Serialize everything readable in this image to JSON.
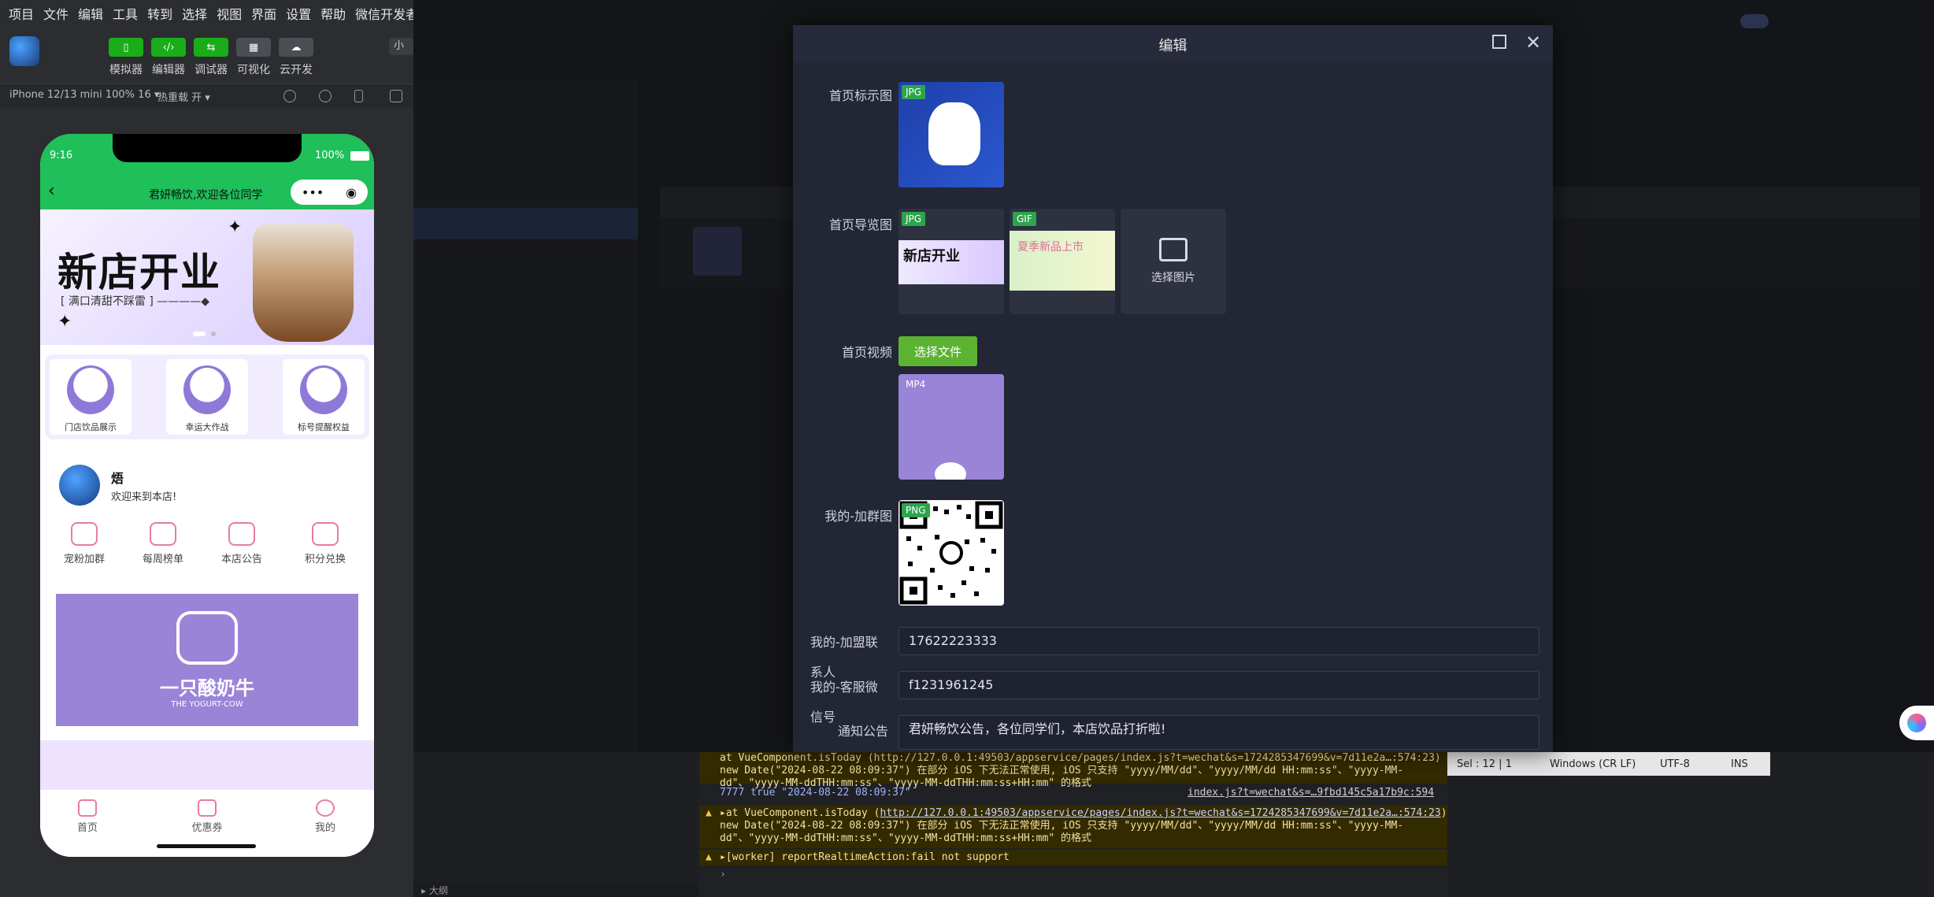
{
  "menubar": [
    "项目",
    "文件",
    "编辑",
    "工具",
    "转到",
    "选择",
    "视图",
    "界面",
    "设置",
    "帮助",
    "微信开发者工具"
  ],
  "toolbar": {
    "items": [
      {
        "icon": "phone-icon",
        "label": "模拟器"
      },
      {
        "icon": "code-icon",
        "label": "编辑器"
      },
      {
        "icon": "debug-icon",
        "label": "调试器"
      },
      {
        "icon": "visual-icon",
        "label": "可视化"
      },
      {
        "icon": "cloud-icon",
        "label": "云开发"
      }
    ],
    "small_btn": "小程"
  },
  "simulator": {
    "device": "iPhone 12/13 mini 100% 16 ▾",
    "hot_reload": "热重载 开 ▾"
  },
  "phone": {
    "time": "9:16",
    "battery": "100%",
    "nav_title": "君妍畅饮,欢迎各位同学",
    "capsule_dots": "•••",
    "banner_title": "新店开业",
    "banner_sub": "[ 满口清甜不踩雷 ] ————◆",
    "cards": [
      "门店饮品展示",
      "幸运大作战",
      "标号提醒权益"
    ],
    "user_name": "焐",
    "user_welcome": "欢迎来到本店!",
    "grid": [
      "宠粉加群",
      "每周榜单",
      "本店公告",
      "积分兑换"
    ],
    "brand_name": "一只酸奶牛",
    "brand_en": "THE YOGURT-COW",
    "tabs": [
      "首页",
      "优惠券",
      "我的"
    ]
  },
  "modal": {
    "title": "编辑",
    "labels": {
      "logo": "首页标示图",
      "carousel": "首页导览图",
      "video": "首页视频",
      "group": "我的-加群图",
      "franchise_l1": "我的-加盟联",
      "franchise_l2": "系人",
      "service_l1": "我的-客服微",
      "service_l2": "信号",
      "notice": "通知公告"
    },
    "badges": {
      "logo": "JPG",
      "car1": "JPG",
      "car2": "GIF",
      "video": "MP4",
      "group": "PNG"
    },
    "car1_text": "新店开业",
    "car2_text": "夏季新品上市",
    "choose_image": "选择图片",
    "choose_file": "选择文件",
    "franchise_value": "17622223333",
    "service_value": "f1231961245",
    "notice_value": "君妍畅饮公告，各位同学们，本店饮品打折啦!"
  },
  "console": {
    "line0": "at VueComponent.isToday (http://127.0.0.1:49503/appservice/pages/index.js?t=wechat&s=1724285347699&v=7d11e2a…:574:23)",
    "line1a": "new Date(\"2024-08-22 08:09:37\") 在部分 iOS 下无法正常使用, iOS 只支持 \"yyyy/MM/dd\"、\"yyyy/MM/dd HH:mm:ss\"、\"yyyy-MM-",
    "line1b": "dd\"、\"yyyy-MM-ddTHH:mm:ss\"、\"yyyy-MM-ddTHH:mm:ss+HH:mm\" 的格式",
    "log": "7777 true \"2024-08-22 08:09:37\"",
    "log_src": "index.js?t=wechat&s=…9fbd145c5a17b9c:594",
    "warn2_prefix": "▸at VueComponent.isToday (",
    "warn2_link": "http://127.0.0.1:49503/appservice/pages/index.js?t=wechat&s=1724285347699&v=7d11e2a…:574:23",
    "warn2_suffix": ")",
    "warn2_a": "new Date(\"2024-08-22 08:09:37\") 在部分 iOS 下无法正常使用, iOS 只支持 \"yyyy/MM/dd\"、\"yyyy/MM/dd HH:mm:ss\"、\"yyyy-MM-",
    "warn2_b": "dd\"、\"yyyy-MM-ddTHH:mm:ss\"、\"yyyy-MM-ddTHH:mm:ss+HH:mm\" 的格式",
    "warn3": "▸[worker] reportRealtimeAction:fail not support",
    "prompt": "›"
  },
  "statusbar": {
    "pos": "Sel : 12 | 1",
    "eol": "Windows (CR LF)",
    "enc": "UTF-8",
    "mode": "INS"
  },
  "outline": "▸ 大纲"
}
